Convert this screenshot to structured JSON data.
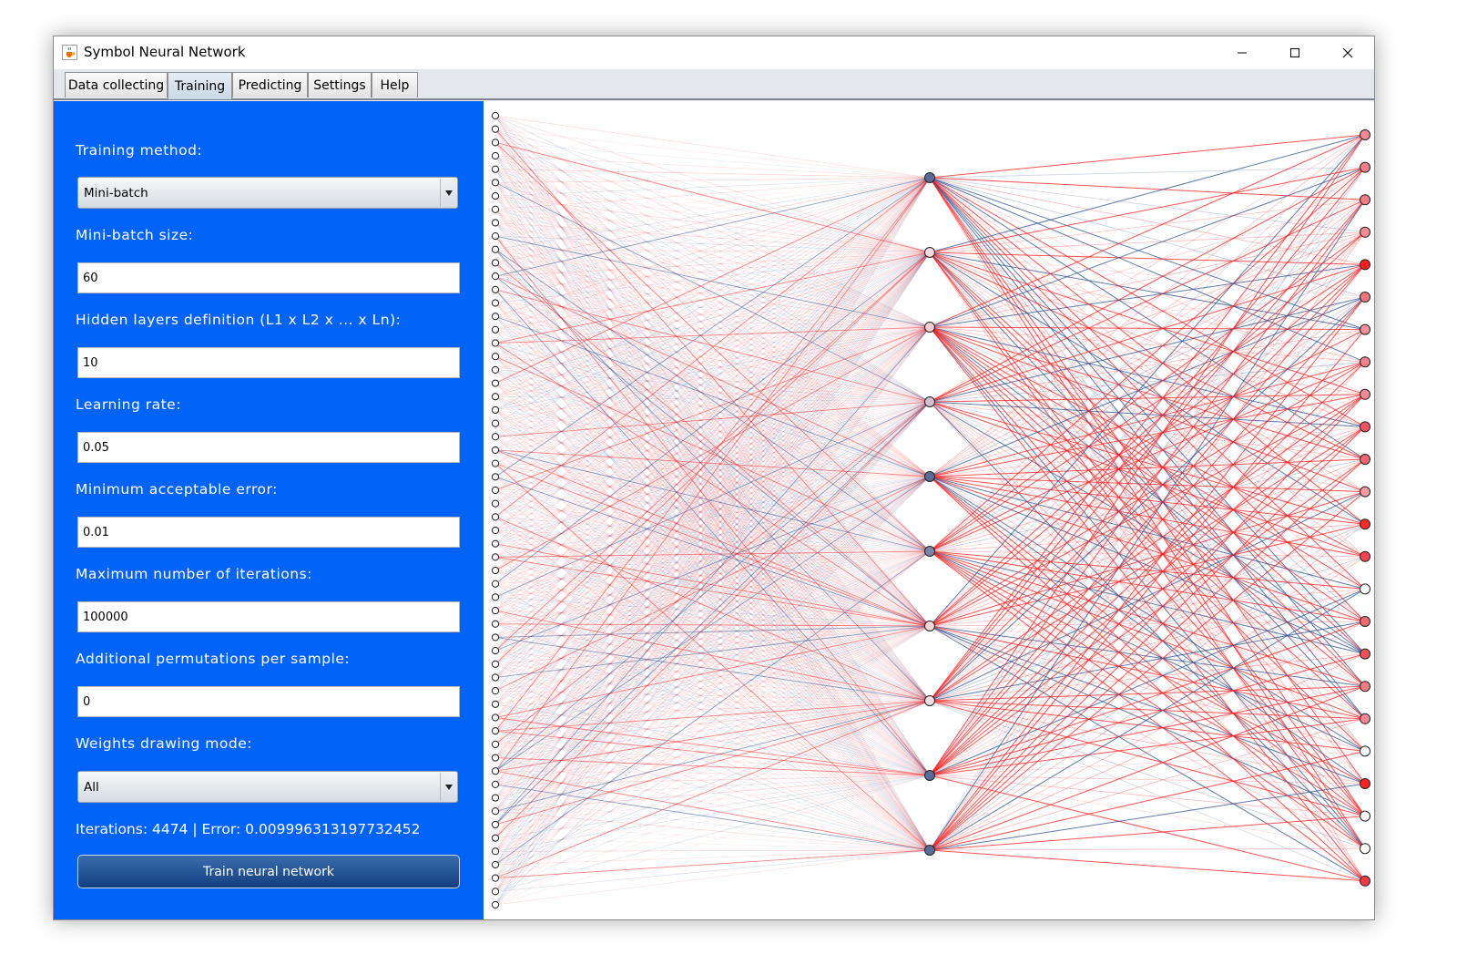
{
  "window": {
    "title": "Symbol Neural Network",
    "icon": "java-cup-icon",
    "controls": [
      "minimize-icon",
      "maximize-icon",
      "close-icon"
    ]
  },
  "tabs": [
    {
      "label": "Data collecting",
      "active": false
    },
    {
      "label": "Training",
      "active": true
    },
    {
      "label": "Predicting",
      "active": false
    },
    {
      "label": "Settings",
      "active": false
    },
    {
      "label": "Help",
      "active": false
    }
  ],
  "form": {
    "training_method": {
      "label": "Training method:",
      "value": "Mini-batch"
    },
    "mini_batch_size": {
      "label": "Mini-batch size:",
      "value": "60"
    },
    "hidden_layers": {
      "label": "Hidden layers definition (L1 x L2 x ... x Ln):",
      "value": "10"
    },
    "learning_rate": {
      "label": "Learning rate:",
      "value": "0.05"
    },
    "min_error": {
      "label": "Minimum acceptable error:",
      "value": "0.01"
    },
    "max_iterations": {
      "label": "Maximum number of iterations:",
      "value": "100000"
    },
    "permutations": {
      "label": "Additional permutations per sample:",
      "value": "0"
    },
    "drawing_mode": {
      "label": "Weights drawing mode:",
      "value": "All"
    }
  },
  "status": "Iterations: 4474 | Error: 0.009996313197732452",
  "train_button_label": "Train neural network",
  "colors": {
    "panel_bg": "#0263f8",
    "positive_weight": "#ff1a1a",
    "negative_weight": "#2a4d8f",
    "active_node": "#ff2020",
    "neutral_node": "#ffffff"
  },
  "network": {
    "layers": [
      60,
      10,
      24
    ],
    "hidden_node_fill": [
      "#5a6c96",
      "#f4dbe0",
      "#f0ccd3",
      "#d4bfd0",
      "#5a6c96",
      "#7d84a6",
      "#f2d6da",
      "#f4dde0",
      "#5a6c96",
      "#5a6c96"
    ],
    "output_node_fill": [
      "#f58a94",
      "#f47c87",
      "#f47c87",
      "#f48a94",
      "#ff1f1f",
      "#f2767f",
      "#f58f99",
      "#f4808a",
      "#f58a94",
      "#f0555f",
      "#f36570",
      "#f79aa3",
      "#ff2a2a",
      "#f1444e",
      "#ffffff",
      "#f26a74",
      "#f0505a",
      "#f47c87",
      "#f58a94",
      "#ffffff",
      "#ff2222",
      "#ffffff",
      "#ffffff",
      "#f03a45"
    ]
  }
}
